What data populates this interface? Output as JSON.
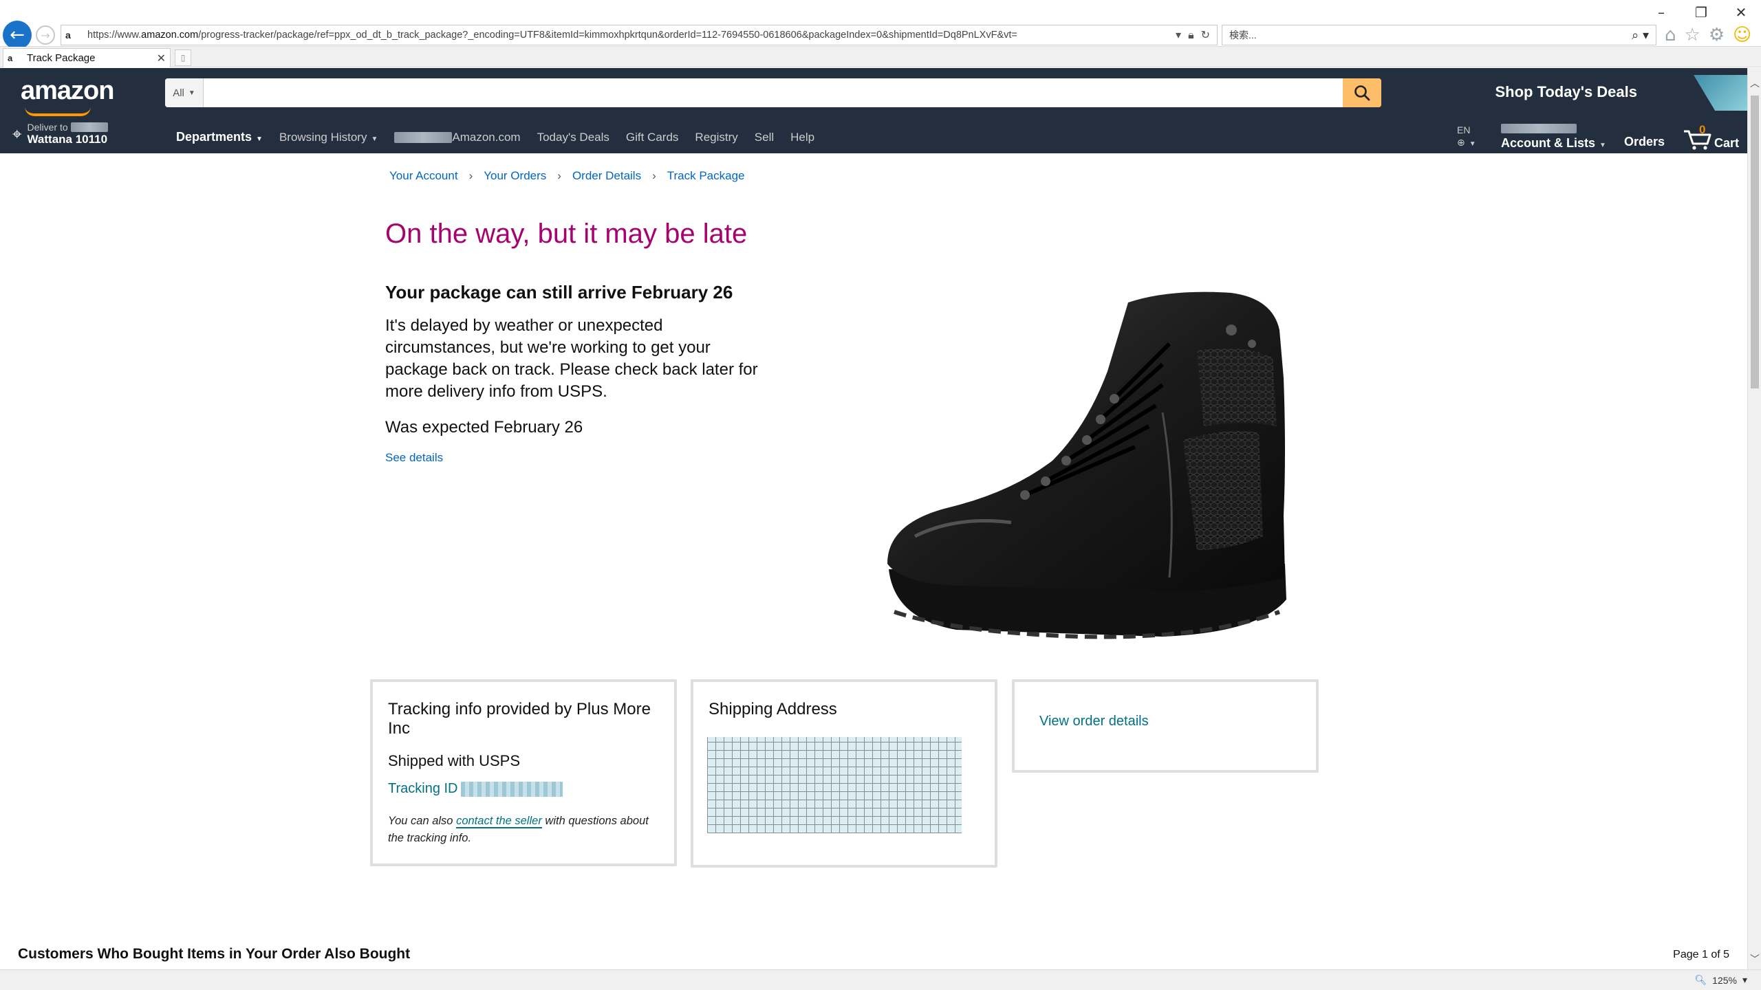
{
  "browser": {
    "url_prefix": "https://www.",
    "url_host": "amazon.com",
    "url_path": "/progress-tracker/package/ref=ppx_od_dt_b_track_package?_encoding=UTF8&itemId=kimmoxhpkrtqun&orderId=112-7694550-0618606&packageIndex=0&shipmentId=Dq8PnLXvF&vt=",
    "search_placeholder": "検索...",
    "tab_title": "Track Package",
    "zoom": "125%",
    "window_buttons": [
      "–",
      "❐",
      "✕"
    ]
  },
  "header": {
    "logo": "amazon",
    "search_category": "All",
    "search_value": "",
    "promo": "Shop Today's Deals",
    "deliver_label": "Deliver to",
    "deliver_location": "Wattana 10110",
    "nav": {
      "departments": "Departments",
      "browsing_history": "Browsing History",
      "amazon_com": "Amazon.com",
      "todays_deals": "Today's Deals",
      "gift_cards": "Gift Cards",
      "registry": "Registry",
      "sell": "Sell",
      "help": "Help"
    },
    "lang": "EN",
    "account_lists": "Account & Lists",
    "orders": "Orders",
    "cart_count": "0",
    "cart": "Cart"
  },
  "breadcrumb": [
    "Your Account",
    "Your Orders",
    "Order Details",
    "Track Package"
  ],
  "breadcrumb_sep": "›",
  "status": {
    "title": "On the way, but it may be late",
    "arrive": "Your package can still arrive February 26",
    "message": "It's delayed by weather or unexpected circumstances, but we're working to get your package back on track. Please check back later for more delivery info from USPS.",
    "was_expected": "Was expected February 26",
    "see_details": "See details"
  },
  "cards": {
    "tracking_title": "Tracking info provided by Plus More Inc",
    "shipped_with": "Shipped with USPS",
    "tracking_id_label": "Tracking ID",
    "contact_pre": "You can also ",
    "contact_link": "contact the seller",
    "contact_post": " with questions about the tracking info.",
    "shipping_title": "Shipping Address",
    "view_order": "View order details"
  },
  "recommendations": {
    "title": "Customers Who Bought Items in Your Order Also Bought",
    "page": "Page 1 of 5"
  },
  "colors": {
    "header_bg": "#232f3e",
    "status_title": "#a5036e",
    "link": "#0066c0",
    "teal_link": "#007185",
    "search_button": "#febd69"
  }
}
